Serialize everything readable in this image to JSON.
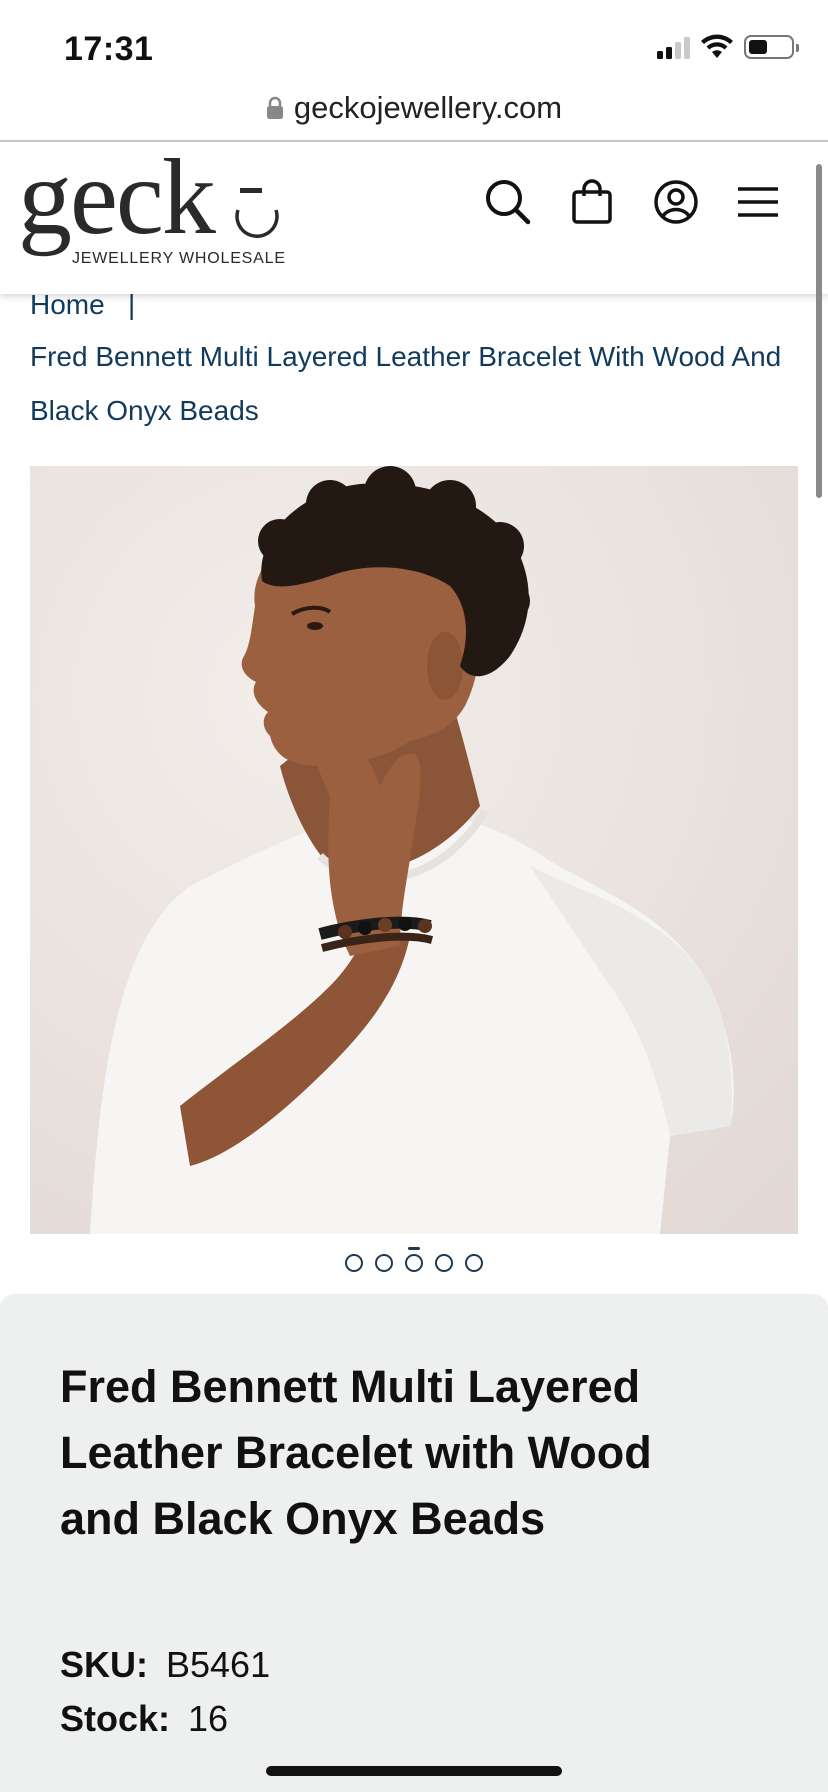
{
  "status_bar": {
    "time": "17:31"
  },
  "browser": {
    "url": "geckojewellery.com"
  },
  "header": {
    "logo_word": "geck",
    "logo_tagline": "JEWELLERY WHOLESALE",
    "icons": [
      "search-icon",
      "cart-icon",
      "account-icon",
      "menu-icon"
    ]
  },
  "breadcrumb": {
    "home": "Home",
    "separator": "|",
    "current": "Fred Bennett Multi Layered Leather Bracelet With Wood And Black Onyx Beads"
  },
  "carousel": {
    "slide_count": 5,
    "active_index": 2
  },
  "product": {
    "title": "Fred Bennett Multi Layered Leather Bracelet with Wood and Black Onyx Beads",
    "sku_label": "SKU:",
    "sku": "B5461",
    "stock_label": "Stock:",
    "stock": "16"
  },
  "colors": {
    "brand_text": "#2a2a2a",
    "link": "#123a5c",
    "panel_bg": "#eef0ef"
  }
}
